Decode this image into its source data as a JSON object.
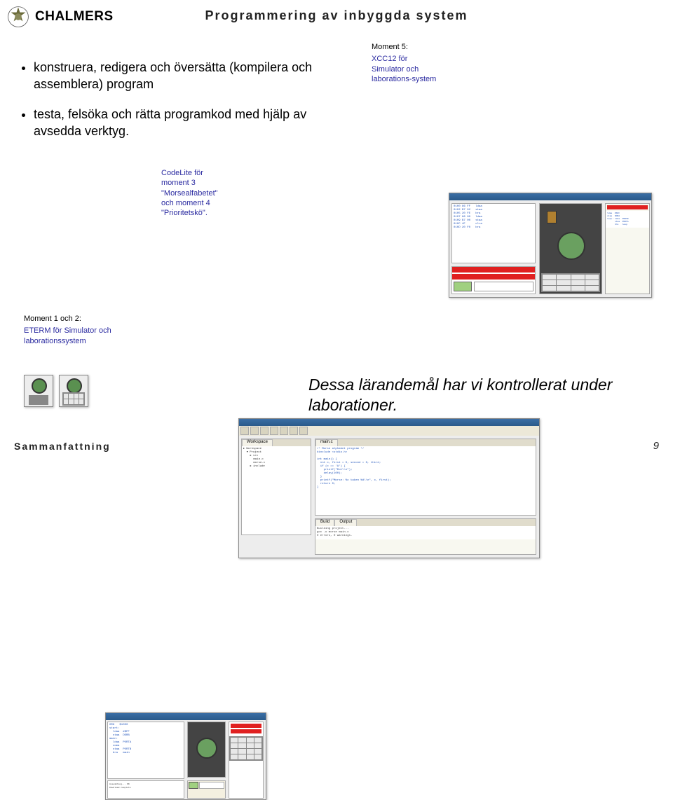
{
  "header": {
    "brand": "CHALMERS",
    "page_title": "Programmering av inbyggda system"
  },
  "bullets": [
    "konstruera, redigera och översätta (kompilera och assemblera) program",
    "testa, felsöka och rätta programkod med hjälp av avsedda verktyg."
  ],
  "captions": {
    "moment5_title": "Moment 5:",
    "moment5_body": "XCC12 för Simulator och laborations-system",
    "codelite": "CodeLite för moment 3 \"Morsealfabetet\" och moment 4 \"Prioritetskö\".",
    "moment12_title": "Moment 1 och 2:",
    "moment12_body": "ETERM för Simulator och laborationssystem"
  },
  "conclusion": "Dessa lärandemål har vi kontrollerat under laborationer.",
  "footer": {
    "left": "Sammanfattning",
    "page": "9"
  }
}
